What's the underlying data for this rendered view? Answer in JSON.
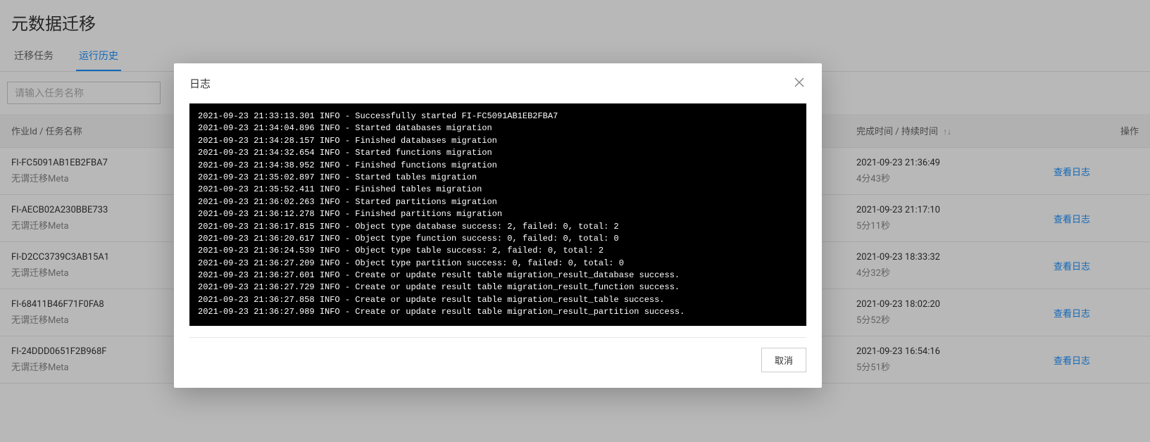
{
  "page_title": "元数据迁移",
  "tabs": [
    {
      "label": "迁移任务"
    },
    {
      "label": "运行历史"
    }
  ],
  "active_tab_index": 1,
  "search_placeholder": "请输入任务名称",
  "columns": {
    "id": "作业Id / 任务名称",
    "time": "完成时间 / 持续时间",
    "action": "操作"
  },
  "rows": [
    {
      "id": "FI-FC5091AB1EB2FBA7",
      "name": "无谓迁移Meta",
      "finish_time": "2021-09-23 21:36:49",
      "duration": "4分43秒",
      "action": "查看日志"
    },
    {
      "id": "FI-AECB02A230BBE733",
      "name": "无谓迁移Meta",
      "finish_time": "2021-09-23 21:17:10",
      "duration": "5分11秒",
      "action": "查看日志"
    },
    {
      "id": "FI-D2CC3739C3AB15A1",
      "name": "无谓迁移Meta",
      "finish_time": "2021-09-23 18:33:32",
      "duration": "4分32秒",
      "action": "查看日志"
    },
    {
      "id": "FI-68411B46F71F0FA8",
      "name": "无谓迁移Meta",
      "finish_time": "2021-09-23 18:02:20",
      "duration": "5分52秒",
      "action": "查看日志"
    },
    {
      "id": "FI-24DDD0651F2B968F",
      "name": "无谓迁移Meta",
      "finish_time": "2021-09-23 16:54:16",
      "duration": "5分51秒",
      "action": "查看日志"
    }
  ],
  "modal": {
    "title": "日志",
    "cancel_label": "取消",
    "log_lines": [
      "2021-09-23 21:33:13.301 INFO - Successfully started FI-FC5091AB1EB2FBA7",
      "2021-09-23 21:34:04.896 INFO - Started databases migration",
      "2021-09-23 21:34:28.157 INFO - Finished databases migration",
      "2021-09-23 21:34:32.654 INFO - Started functions migration",
      "2021-09-23 21:34:38.952 INFO - Finished functions migration",
      "2021-09-23 21:35:02.897 INFO - Started tables migration",
      "2021-09-23 21:35:52.411 INFO - Finished tables migration",
      "2021-09-23 21:36:02.263 INFO - Started partitions migration",
      "2021-09-23 21:36:12.278 INFO - Finished partitions migration",
      "2021-09-23 21:36:17.815 INFO - Object type database success: 2, failed: 0, total: 2",
      "2021-09-23 21:36:20.617 INFO - Object type function success: 0, failed: 0, total: 0",
      "2021-09-23 21:36:24.539 INFO - Object type table success: 2, failed: 0, total: 2",
      "2021-09-23 21:36:27.209 INFO - Object type partition success: 0, failed: 0, total: 0",
      "2021-09-23 21:36:27.601 INFO - Create or update result table migration_result_database success.",
      "2021-09-23 21:36:27.729 INFO - Create or update result table migration_result_function success.",
      "2021-09-23 21:36:27.858 INFO - Create or update result table migration_result_table success.",
      "2021-09-23 21:36:27.989 INFO - Create or update result table migration_result_partition success."
    ]
  },
  "sort_glyph": "↑↓"
}
